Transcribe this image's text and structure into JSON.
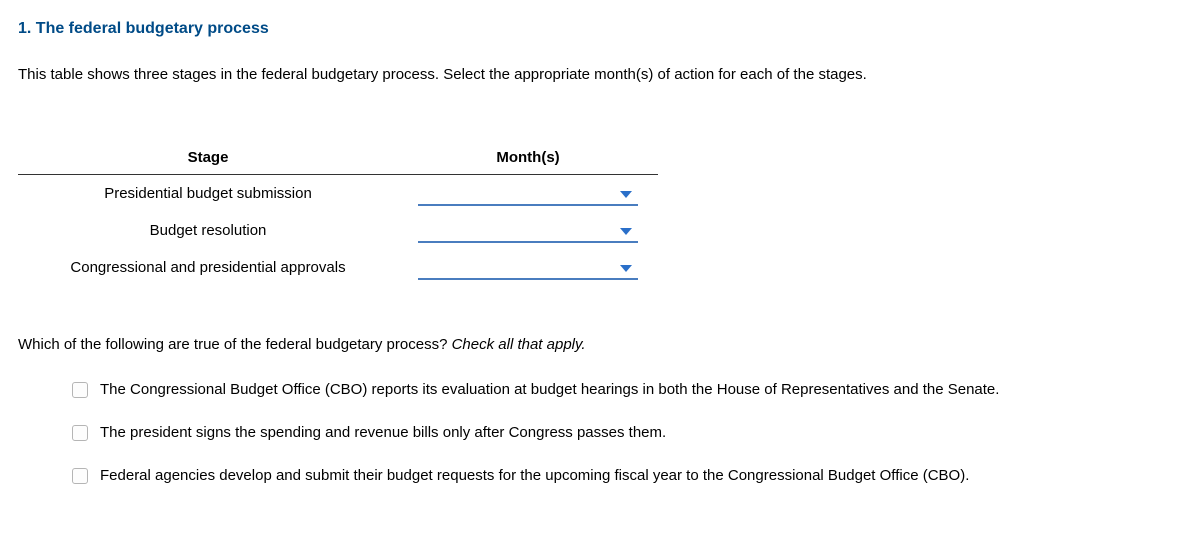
{
  "title": "1. The federal budgetary process",
  "instruction": "This table shows three stages in the federal budgetary process. Select the appropriate month(s) of action for each of the stages.",
  "table": {
    "headers": {
      "stage": "Stage",
      "months": "Month(s)"
    },
    "rows": [
      {
        "stage": "Presidential budget submission",
        "months": ""
      },
      {
        "stage": "Budget resolution",
        "months": ""
      },
      {
        "stage": "Congressional and presidential approvals",
        "months": ""
      }
    ]
  },
  "question2": {
    "prompt": "Which of the following are true of the federal budgetary process? ",
    "hint": "Check all that apply."
  },
  "options": [
    "The Congressional Budget Office (CBO) reports its evaluation at budget hearings in both the House of Representatives and the Senate.",
    "The president signs the spending and revenue bills only after Congress passes them.",
    "Federal agencies develop and submit their budget requests for the upcoming fiscal year to the Congressional Budget Office (CBO)."
  ]
}
